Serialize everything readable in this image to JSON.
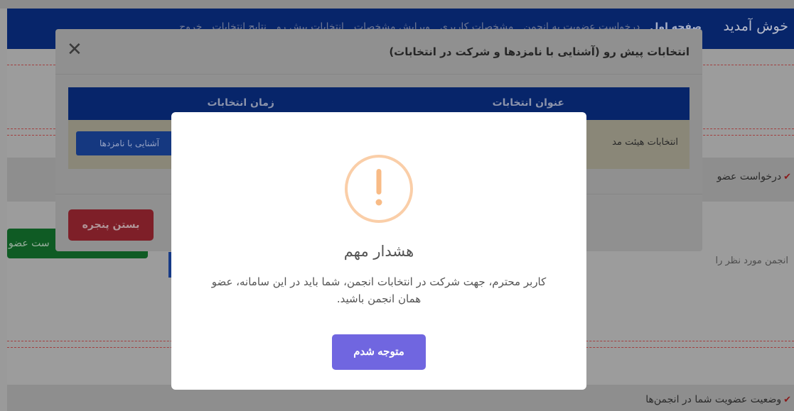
{
  "navbar": {
    "brand": "خوش آمدید",
    "links": [
      "صفحه اول",
      "درخواست عضویت به انجمن",
      "مشخصات کاربری",
      "ویرایش مشخصات",
      "انتخابات پیش رو",
      "نتایج انتخابات",
      "خروج"
    ]
  },
  "background": {
    "section_request": "درخواست عضو",
    "select_label": "انجمن مورد نظر را",
    "green_button": "ست عضو",
    "section_status": "وضعیت عضویت شما در انجمن‌ها"
  },
  "candidates_modal": {
    "title": "انتخابات پیش رو (آشنایی با نامزدها و شرکت در انتخابات)",
    "close_icon": "close-icon",
    "table": {
      "headers": [
        "عنوان انتخابات",
        "زمان انتخابات"
      ],
      "rows": [
        {
          "title": "انتخابات هیئت مد",
          "button": "آشنایی با نامزدها"
        }
      ]
    },
    "close_button": "بستن پنجره"
  },
  "alert": {
    "icon": "warning-icon",
    "icon_color": "#f8bb86",
    "title": "هشدار مهم",
    "message": "کاربر محترم، جهت شرکت در انتخابات انجمن، شما باید در این سامانه، عضو همان انجمن باشید.",
    "button": "متوجه شدم",
    "button_color": "#7066e0"
  }
}
